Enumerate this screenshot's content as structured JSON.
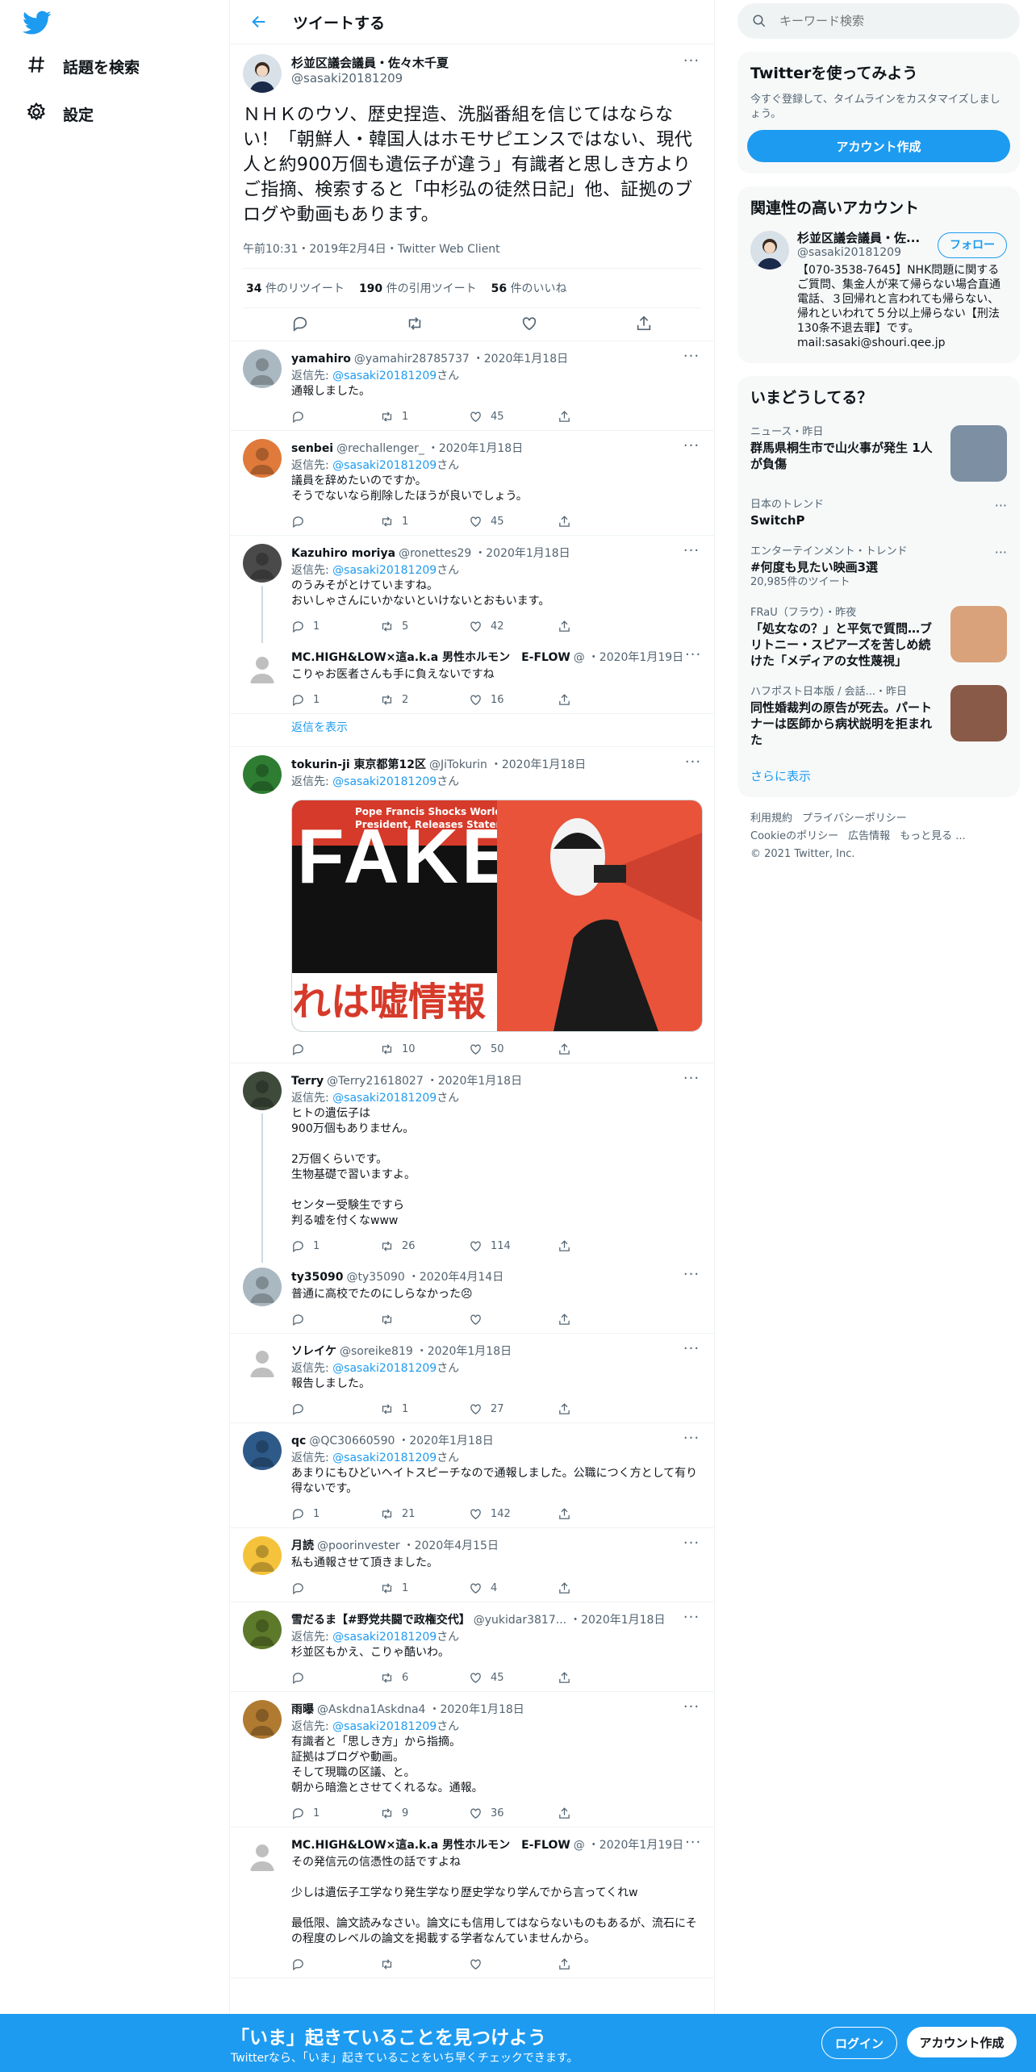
{
  "nav": {
    "explore_label": "話題を検索",
    "settings_label": "設定"
  },
  "header": {
    "title": "ツイートする"
  },
  "focal": {
    "name": "杉並区議会議員・佐々木千夏",
    "handle": "@sasaki20181209",
    "text": "ＮＨＫのウソ、歴史捏造、洗脳番組を信じてはならない！「朝鮮人・韓国人はホモサピエンスではない、現代人と約900万個も遺伝子が違う」有識者と思しき方よりご指摘、検索すると「中杉弘の徒然日記」他、証拠のブログや動画もあります。",
    "meta": "午前10:31・2019年2月4日・Twitter Web Client",
    "retweets": "34",
    "retweets_label": "件のリツイート",
    "quotes": "190",
    "quotes_label": "件の引用ツイート",
    "likes": "56",
    "likes_label": "件のいいね"
  },
  "reply_prefix": "返信先: ",
  "reply_suffix": "さん",
  "replies": [
    {
      "name": "yamahiro",
      "handle": "@yamahir28785737",
      "time": "・2020年1月18日",
      "reply_to": "@sasaki20181209",
      "text": "通報しました。",
      "replies": "",
      "retweets": "1",
      "likes": "45"
    },
    {
      "name": "senbei",
      "handle": "@rechallenger_",
      "time": "・2020年1月18日",
      "reply_to": "@sasaki20181209",
      "text": "議員を辞めたいのですか。\nそうでないなら削除したほうが良いでしょう。",
      "replies": "",
      "retweets": "1",
      "likes": "45"
    },
    {
      "name": "Kazuhiro moriya",
      "handle": "@ronettes29",
      "time": "・2020年1月18日",
      "reply_to": "@sasaki20181209",
      "text": "のうみそがとけていますね。\nおいしゃさんにいかないといけないとおもいます。",
      "replies": "1",
      "retweets": "5",
      "likes": "42"
    },
    {
      "name": "MC.HIGH&LOW×這a.k.a 男性ホルモン　E-FLOW",
      "handle": "@",
      "time": "・2020年1月19日",
      "reply_to": "",
      "text": "こりゃお医者さんも手に負えないですね",
      "replies": "1",
      "retweets": "2",
      "likes": "16"
    },
    {
      "name": "tokurin-ji 東京都第12区",
      "handle": "@JiTokurin",
      "time": "・2020年1月18日",
      "reply_to": "@sasaki20181209",
      "text": "",
      "replies": "",
      "retweets": "10",
      "likes": "50"
    },
    {
      "name": "Terry",
      "handle": "@Terry21618027",
      "time": "・2020年1月18日",
      "reply_to": "@sasaki20181209",
      "text": "ヒトの遺伝子は\n900万個もありません。\n\n2万個くらいです。\n生物基礎で習いますよ。\n\nセンター受験生ですら\n判る嘘を付くなwww",
      "replies": "1",
      "retweets": "26",
      "likes": "114"
    },
    {
      "name": "ty35090",
      "handle": "@ty35090",
      "time": "・2020年4月14日",
      "reply_to": "",
      "text": "普通に高校でたのにしらなかった😣",
      "replies": "",
      "retweets": "",
      "likes": ""
    },
    {
      "name": "ソレイケ",
      "handle": "@soreike819",
      "time": "・2020年1月18日",
      "reply_to": "@sasaki20181209",
      "text": "報告しました。",
      "replies": "",
      "retweets": "1",
      "likes": "27"
    },
    {
      "name": "qc",
      "handle": "@QC30660590",
      "time": "・2020年1月18日",
      "reply_to": "@sasaki20181209",
      "text": "あまりにもひどいヘイトスピーチなので通報しました。公職につく方として有り得ないです。",
      "replies": "1",
      "retweets": "21",
      "likes": "142"
    },
    {
      "name": "月読",
      "handle": "@poorinvester",
      "time": "・2020年4月15日",
      "reply_to": "",
      "text": "私も通報させて頂きました。",
      "replies": "",
      "retweets": "1",
      "likes": "4"
    },
    {
      "name": "雪だるま【#野党共闘で政権交代】",
      "handle": "@yukidar3817...",
      "time": "・2020年1月18日",
      "reply_to": "@sasaki20181209",
      "text": "杉並区もかえ、こりゃ酷いわ。",
      "replies": "",
      "retweets": "6",
      "likes": "45"
    },
    {
      "name": "雨曝",
      "handle": "@Askdna1Askdna4",
      "time": "・2020年1月18日",
      "reply_to": "@sasaki20181209",
      "text": "有識者と「思しき方」から指摘。\n証拠はブログや動画。\nそして現職の区議、と。\n朝から暗澹とさせてくれるな。通報。",
      "replies": "1",
      "retweets": "9",
      "likes": "36"
    },
    {
      "name": "MC.HIGH&LOW×這a.k.a 男性ホルモン　E-FLOW",
      "handle": "@",
      "time": "・2020年1月19日",
      "reply_to": "",
      "text": "その発信元の信憑性の話ですよね\n\n少しは遺伝子工学なり発生学なり歴史学なり学んでから言ってくれw\n\n最低限、論文読みなさい。論文にも信用してはならないものもあるが、流石にその程度のレベルの論文を掲載する学者なんていませんから。",
      "replies": "",
      "retweets": "",
      "likes": ""
    }
  ],
  "show_thread": "返信を表示",
  "media": {
    "headline": "Pope Francis Shocks World, Endorses\nPresident, Releases Statement",
    "big_word": "FAKE",
    "sub_word": "れは嘘情報"
  },
  "search": {
    "placeholder": "キーワード検索"
  },
  "join": {
    "title": "Twitterを使ってみよう",
    "sub": "今すぐ登録して、タイムラインをカスタマイズしましょう。",
    "button": "アカウント作成"
  },
  "related": {
    "title": "関連性の高いアカウント",
    "name": "杉並区議会議員・佐...",
    "handle": "@sasaki20181209",
    "follow": "フォロー",
    "bio": "【070-3538-7645】NHK問題に関するご質問、集金人が来て帰らない場合直通電話、３回帰れと言われても帰らない、帰れといわれて５分以上帰らない【刑法130条不退去罪】です。mail:sasaki@shouri.qee.jp"
  },
  "trends": {
    "title": "いまどうしてる？",
    "items": [
      {
        "category": "ニュース・昨日",
        "title": "群馬県桐生市で山火事が発生 1人が負傷",
        "count": "",
        "has_image": true
      },
      {
        "category": "日本のトレンド",
        "title": "SwitchP",
        "count": "",
        "has_image": false
      },
      {
        "category": "エンターテインメント・トレンド",
        "title": "#何度も見たい映画3選",
        "count": "20,985件のツイート",
        "has_image": false
      },
      {
        "category": "FRaU（フラウ）・昨夜",
        "title": "「処女なの？」と平気で質問…ブリトニー・スピアーズを苦しめ続けた「メディアの女性蔑視」",
        "count": "",
        "has_image": true
      },
      {
        "category": "ハフポスト日本版 / 会話...・昨日",
        "title": "同性婚裁判の原告が死去。パートナーは医師から病状説明を拒まれた",
        "count": "",
        "has_image": true
      }
    ],
    "show_more": "さらに表示"
  },
  "footer": {
    "links": [
      "利用規約",
      "プライバシーポリシー",
      "Cookieのポリシー",
      "広告情報",
      "もっと見る ..."
    ],
    "copyright": "© 2021 Twitter, Inc."
  },
  "bottom": {
    "title": "「いま」起きていることを見つけよう",
    "sub": "Twitterなら、「いま」起きていることをいち早くチェックできます。",
    "login": "ログイン",
    "signup": "アカウント作成"
  },
  "colors": {
    "accent": "#1d9bf0",
    "text": "#0f1419",
    "muted": "#536471"
  }
}
